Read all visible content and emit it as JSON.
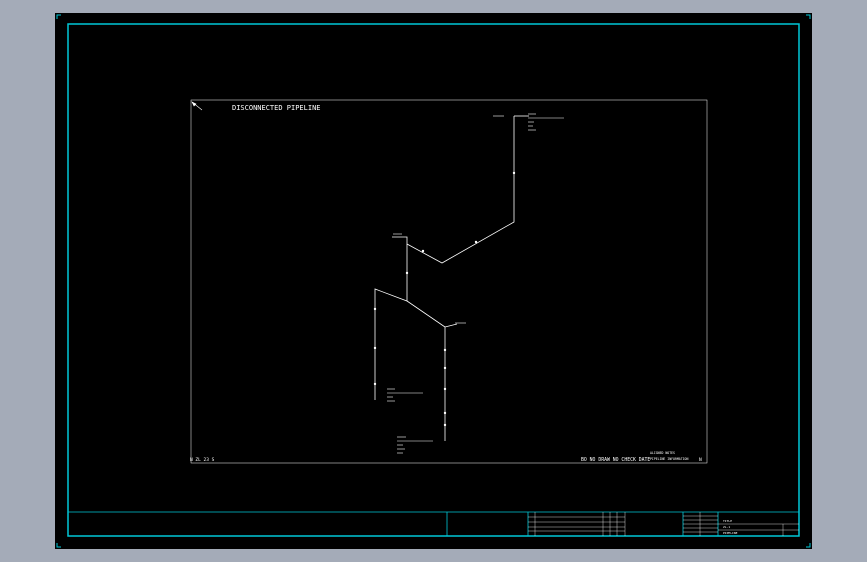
{
  "drawing": {
    "title": "DISCONNECTED PIPELINE",
    "bottom_left_label": "N ZL 23 S",
    "bottom_right_label": "BO NO DRAW NO CHECK DATE",
    "bottom_right_note_1": "ALIGNED NOTES",
    "bottom_right_note_2": "PIPELINE INFORMATION",
    "corner_mark": "N"
  },
  "colors": {
    "background_outer": "#a4abb8",
    "sheet": "#000000",
    "border": "#00c8d8",
    "lines": "#ffffff"
  },
  "title_block": {
    "label_1": "TITLE",
    "label_2": "ZL-1",
    "label_3": "PIPELINE"
  }
}
